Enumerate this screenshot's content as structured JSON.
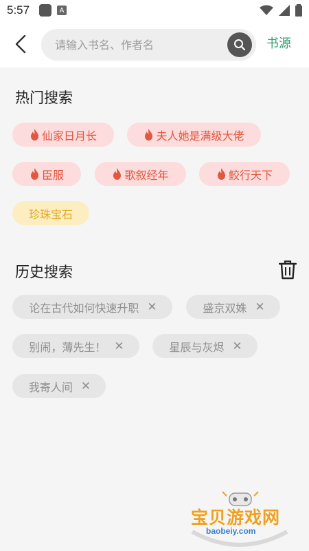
{
  "status_bar": {
    "time": "5:57"
  },
  "header": {
    "search_placeholder": "请输入书名、作者名",
    "source_label": "书源"
  },
  "hot": {
    "title": "热门搜索",
    "items": [
      {
        "label": "仙家日月长",
        "style": "hot"
      },
      {
        "label": "夫人她是满级大佬",
        "style": "hot"
      },
      {
        "label": "臣服",
        "style": "hot"
      },
      {
        "label": "歌叙经年",
        "style": "hot"
      },
      {
        "label": "鲛行天下",
        "style": "hot"
      },
      {
        "label": "珍珠宝石",
        "style": "gold"
      }
    ]
  },
  "history": {
    "title": "历史搜索",
    "items": [
      {
        "label": "论在古代如何快速升职"
      },
      {
        "label": "盛京双姝"
      },
      {
        "label": "别闹，薄先生！"
      },
      {
        "label": "星辰与灰烬"
      },
      {
        "label": "我寄人间"
      }
    ]
  },
  "watermark": {
    "text": "宝贝游戏网",
    "url": "baobeiy.com"
  },
  "colors": {
    "accent": "#3aa070",
    "hot_bg": "#fcdcdc",
    "hot_text": "#e2573f",
    "gold_bg": "#fdeec2",
    "gold_text": "#e2a820",
    "history_bg": "#e6e6e6"
  }
}
